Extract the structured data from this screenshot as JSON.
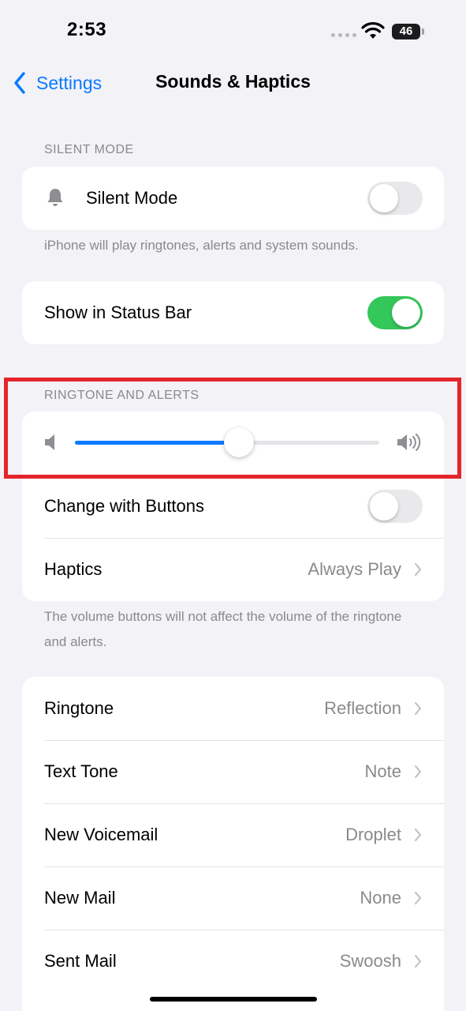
{
  "status_bar": {
    "time": "2:53",
    "battery_level": "46",
    "icons": [
      "signal-dots-icon",
      "wifi-icon",
      "battery-icon"
    ]
  },
  "nav": {
    "back_label": "Settings",
    "title": "Sounds & Haptics"
  },
  "silent_section": {
    "header": "SILENT MODE",
    "silent_mode": {
      "label": "Silent Mode",
      "icon": "bell-icon",
      "on": false
    },
    "footer": "iPhone will play ringtones, alerts and system sounds."
  },
  "status_bar_section": {
    "show_in_status_bar": {
      "label": "Show in Status Bar",
      "on": true
    }
  },
  "ringtone_section": {
    "header": "RINGTONE AND ALERTS",
    "volume_level": 0.54,
    "volume_low_icon": "speaker-low-icon",
    "volume_high_icon": "speaker-high-icon",
    "change_with_buttons": {
      "label": "Change with Buttons",
      "on": false
    },
    "haptics": {
      "label": "Haptics",
      "value": "Always Play"
    },
    "footer": "The volume buttons will not affect the volume of the ringtone and alerts."
  },
  "sounds_list": [
    {
      "label": "Ringtone",
      "value": "Reflection"
    },
    {
      "label": "Text Tone",
      "value": "Note"
    },
    {
      "label": "New Voicemail",
      "value": "Droplet"
    },
    {
      "label": "New Mail",
      "value": "None"
    },
    {
      "label": "Sent Mail",
      "value": "Swoosh"
    }
  ],
  "colors": {
    "accent": "#0a7aff",
    "toggle_on": "#34c759",
    "toggle_off": "#e9e9eb",
    "highlight": "#e5242b",
    "background": "#f2f2f7"
  }
}
